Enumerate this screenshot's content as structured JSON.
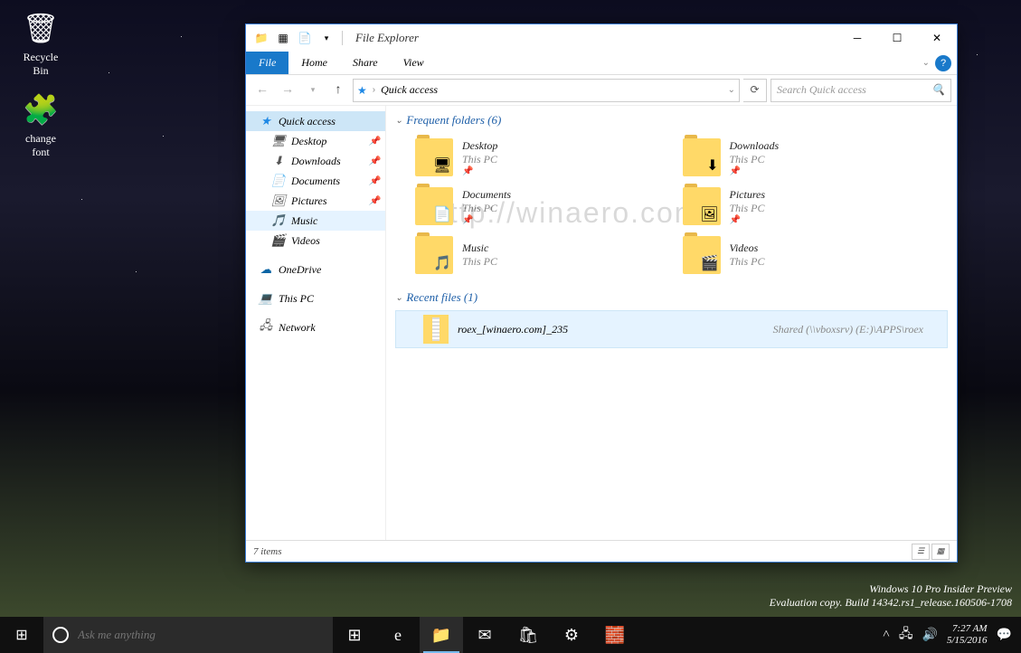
{
  "desktop": {
    "icons": [
      {
        "name": "Recycle\nBin",
        "glyph": "🗑"
      },
      {
        "name": "change\nfont",
        "glyph": "🧩"
      }
    ],
    "watermark_line1": "Windows 10 Pro Insider Preview",
    "watermark_line2": "Evaluation copy. Build 14342.rs1_release.160506-1708"
  },
  "window": {
    "title": "File Explorer",
    "tabs": {
      "file": "File",
      "home": "Home",
      "share": "Share",
      "view": "View"
    },
    "address": {
      "crumb": "Quick access"
    },
    "search": {
      "placeholder": "Search Quick access"
    },
    "nav": [
      {
        "label": "Quick access",
        "icon": "★",
        "color": "#1e88e5",
        "sel": true
      },
      {
        "label": "Desktop",
        "icon": "🖥",
        "sub": true,
        "pin": true
      },
      {
        "label": "Downloads",
        "icon": "⬇",
        "sub": true,
        "pin": true
      },
      {
        "label": "Documents",
        "icon": "📄",
        "sub": true,
        "pin": true
      },
      {
        "label": "Pictures",
        "icon": "🖼",
        "sub": true,
        "pin": true
      },
      {
        "label": "Music",
        "icon": "🎵",
        "sub": true,
        "hov": true
      },
      {
        "label": "Videos",
        "icon": "🎬",
        "sub": true
      },
      {
        "label": "OneDrive",
        "icon": "☁",
        "color": "#0a64a4",
        "gap": true
      },
      {
        "label": "This PC",
        "icon": "💻",
        "gap": true
      },
      {
        "label": "Network",
        "icon": "🖧",
        "gap": true
      }
    ],
    "sections": {
      "frequent": {
        "header": "Frequent folders (6)",
        "items": [
          {
            "name": "Desktop",
            "loc": "This PC",
            "pin": true,
            "ov": "🖥"
          },
          {
            "name": "Downloads",
            "loc": "This PC",
            "pin": true,
            "ov": "⬇"
          },
          {
            "name": "Documents",
            "loc": "This PC",
            "pin": true,
            "ov": "📄"
          },
          {
            "name": "Pictures",
            "loc": "This PC",
            "pin": true,
            "ov": "🖼"
          },
          {
            "name": "Music",
            "loc": "This PC",
            "ov": "🎵"
          },
          {
            "name": "Videos",
            "loc": "This PC",
            "ov": "🎬"
          }
        ]
      },
      "recent": {
        "header": "Recent files (1)",
        "items": [
          {
            "name": "roex_[winaero.com]_235",
            "path": "Shared (\\\\vboxsrv) (E:)\\APPS\\roex"
          }
        ]
      }
    },
    "status": "7 items",
    "content_watermark": "http://winaero.com"
  },
  "taskbar": {
    "cortana_placeholder": "Ask me anything",
    "items": [
      {
        "name": "task-view",
        "glyph": "⊞"
      },
      {
        "name": "edge",
        "glyph": "e"
      },
      {
        "name": "explorer",
        "glyph": "📁",
        "active": true
      },
      {
        "name": "mail",
        "glyph": "✉"
      },
      {
        "name": "store",
        "glyph": "🛍"
      },
      {
        "name": "settings",
        "glyph": "⚙"
      },
      {
        "name": "app",
        "glyph": "🧱"
      }
    ],
    "clock": {
      "time": "7:27 AM",
      "date": "5/15/2016"
    }
  }
}
